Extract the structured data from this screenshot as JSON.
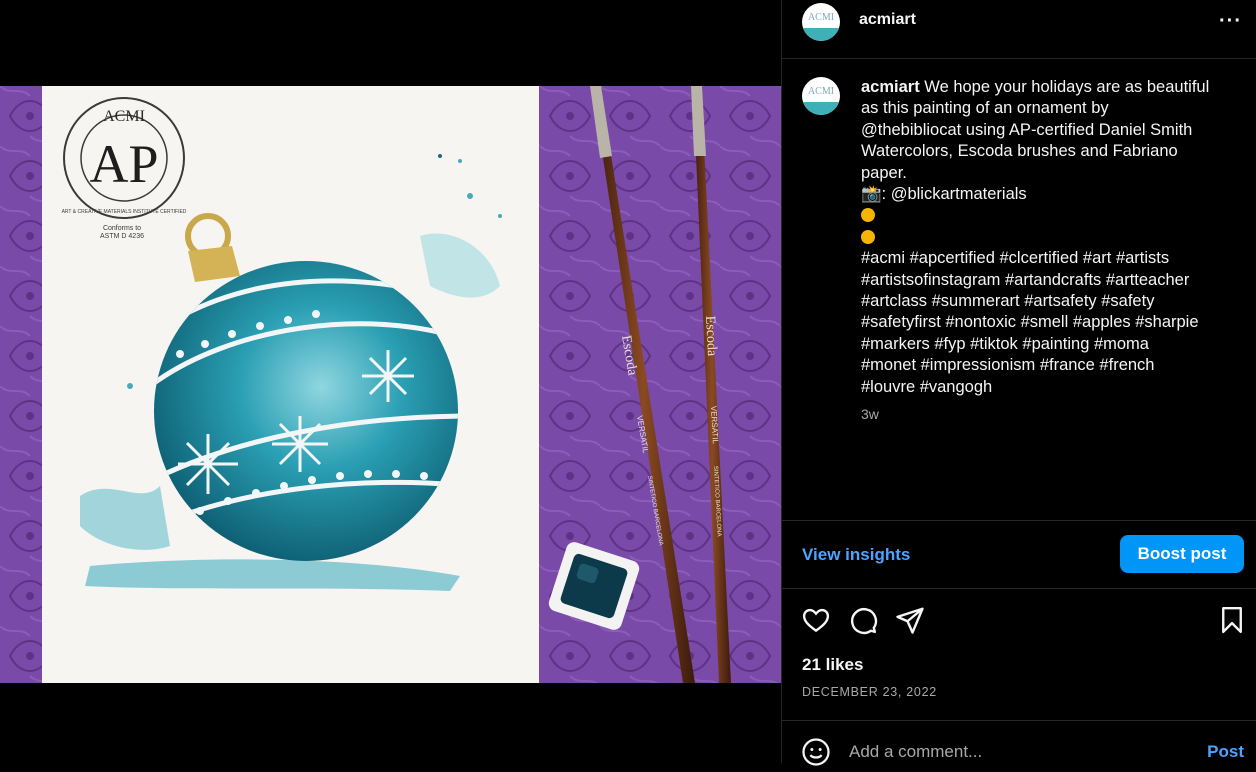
{
  "post": {
    "username": "acmiart",
    "avatar_text": "ACMI",
    "caption": {
      "username": "acmiart",
      "lines": [
        "We hope your holidays are as beautiful",
        "as this painting of an ornament by",
        "@thebibliocat using AP-certified Daniel Smith",
        "Watercolors, Escoda brushes and Fabriano",
        "paper."
      ],
      "camera_prefix": "📸",
      "camera_credit": ": @blickartmaterials",
      "hashtag_lines": [
        "#acmi #apcertified #clcertified #art #artists",
        "#artistsofinstagram #artandcrafts #artteacher",
        "#artclass #summerart #artsafety #safety",
        "#safetyfirst #nontoxic #smell #apples #sharpie",
        "#markers #fyp #tiktok #painting #moma",
        "#monet #impressionism #france #french",
        "#louvre #vangogh"
      ]
    },
    "time_ago": "3w",
    "likes": "21 likes",
    "date": "DECEMBER 23, 2022"
  },
  "actions": {
    "view_insights": "View insights",
    "boost_post": "Boost post",
    "more": "···"
  },
  "comment": {
    "placeholder": "Add a comment...",
    "post_label": "Post"
  },
  "image": {
    "seal_top": "ACMI",
    "seal_center": "AP",
    "seal_ring": "ART & CREATIVE MATERIALS INSTITUTE CERTIFIED",
    "seal_note_1": "Conforms to",
    "seal_note_2": "ASTM D 4236",
    "brush_brand": "Escoda",
    "brush_line": "VERSATIL",
    "brush_origin": "SINTETICO  BARCELONA"
  },
  "colors": {
    "accent": "#0095f6",
    "link": "#4da3ff",
    "muted": "#a8a8a8",
    "border": "#262626"
  },
  "icons": [
    "more-icon",
    "heart-icon",
    "comment-icon",
    "share-icon",
    "bookmark-icon",
    "emoji-icon"
  ]
}
